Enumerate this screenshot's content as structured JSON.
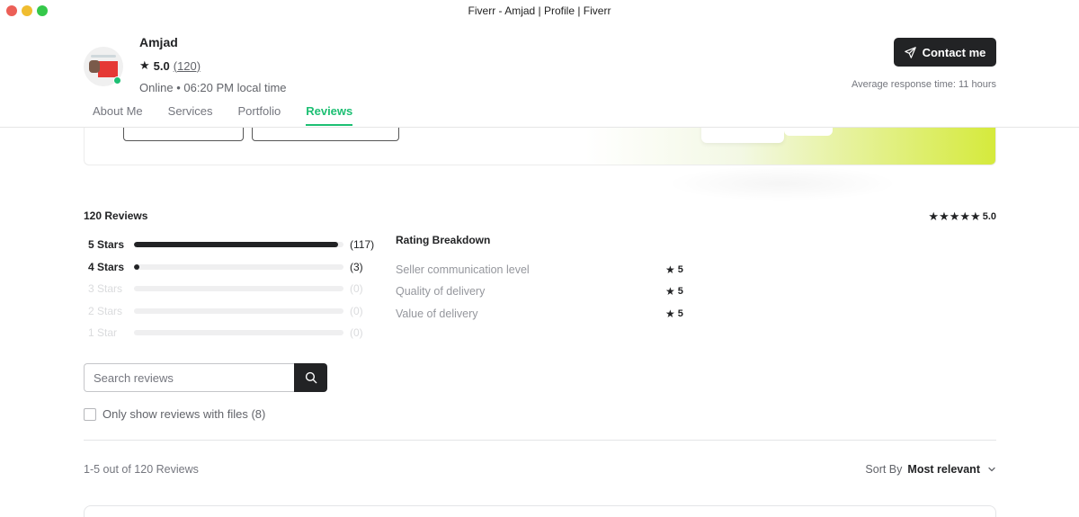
{
  "window": {
    "title": "Fiverr - Amjad | Profile | Fiverr"
  },
  "header": {
    "name": "Amjad",
    "rating": "5.0",
    "rating_count": "(120)",
    "status": "Online • 06:20 PM local time",
    "contact_label": "Contact me",
    "response_time": "Average response time: 11 hours",
    "tabs": [
      {
        "label": "About Me"
      },
      {
        "label": "Services"
      },
      {
        "label": "Portfolio"
      },
      {
        "label": "Reviews",
        "active": true
      }
    ]
  },
  "reviews": {
    "total_label": "120 Reviews",
    "overall_rating": "5.0",
    "star_breakdown": [
      {
        "label": "5 Stars",
        "count": "(117)",
        "fraction": 0.975
      },
      {
        "label": "4 Stars",
        "count": "(3)",
        "fraction": 0.025
      },
      {
        "label": "3 Stars",
        "count": "(0)",
        "fraction": 0
      },
      {
        "label": "2 Stars",
        "count": "(0)",
        "fraction": 0
      },
      {
        "label": "1 Star",
        "count": "(0)",
        "fraction": 0
      }
    ],
    "rating_breakdown": {
      "title": "Rating Breakdown",
      "items": [
        {
          "label": "Seller communication level",
          "score": "5"
        },
        {
          "label": "Quality of delivery",
          "score": "5"
        },
        {
          "label": "Value of delivery",
          "score": "5"
        }
      ]
    },
    "search": {
      "placeholder": "Search reviews"
    },
    "files_filter_label": "Only show reviews with files (8)",
    "results_label": "1-5 out of 120 Reviews",
    "sort": {
      "label": "Sort By",
      "value": "Most relevant"
    }
  },
  "colors": {
    "accent": "#1dbf73",
    "dark": "#222325"
  }
}
